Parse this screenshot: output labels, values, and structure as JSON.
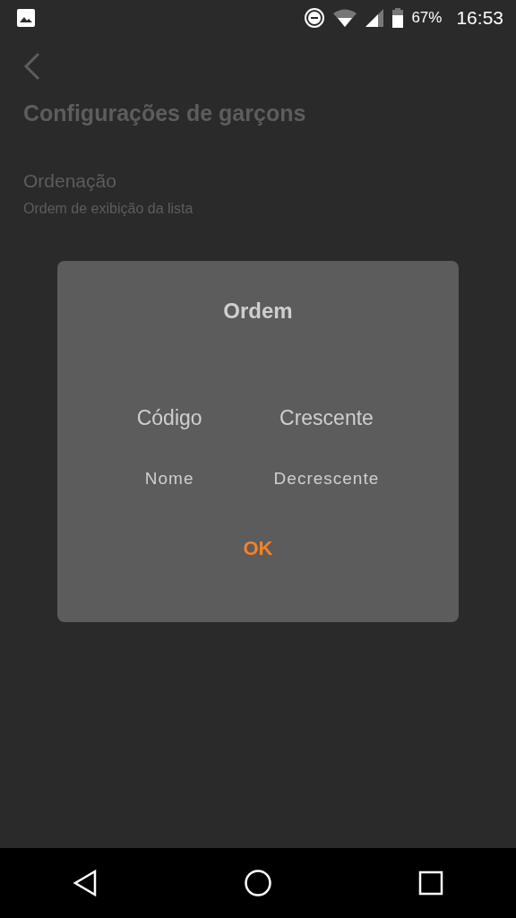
{
  "status_bar": {
    "battery": "67%",
    "time": "16:53"
  },
  "page": {
    "title": "Configurações de garçons",
    "setting": {
      "title": "Ordenação",
      "summary": "Ordem de exibição da lista"
    }
  },
  "dialog": {
    "title": "Ordem",
    "pickers": [
      {
        "items": [
          {
            "label": "Código",
            "selected": true
          },
          {
            "label": "Nome",
            "selected": false
          }
        ]
      },
      {
        "items": [
          {
            "label": "Crescente",
            "selected": true
          },
          {
            "label": "Decrescente",
            "selected": false
          }
        ]
      }
    ],
    "button": "OK"
  }
}
